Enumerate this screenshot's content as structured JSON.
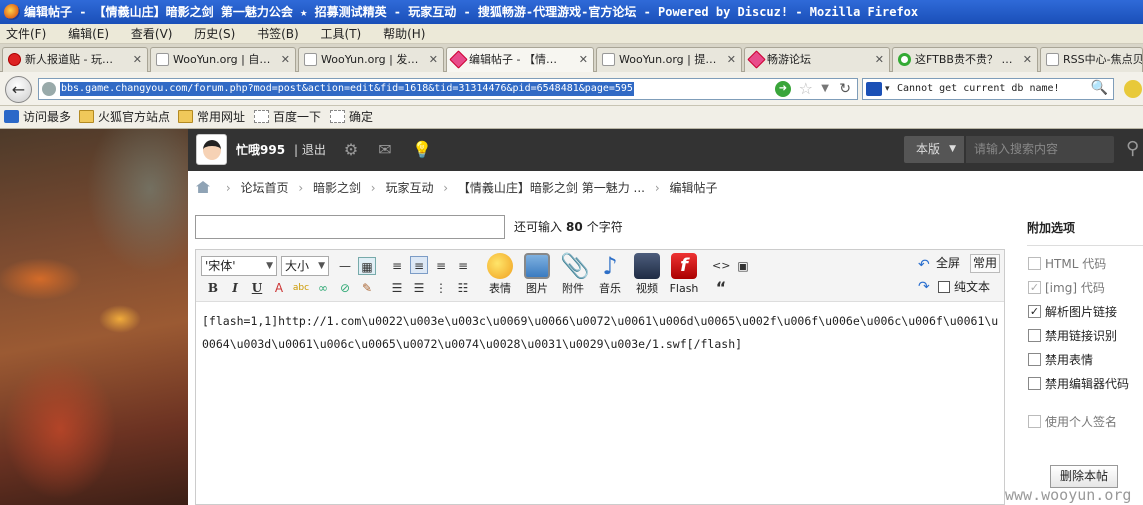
{
  "window": {
    "title": "编辑帖子 - 【情義山庄】暗影之剑 第一魅力公会 ★ 招募测试精英 - 玩家互动 - 搜狐畅游-代理游戏-官方论坛 - Powered by Discuz! - Mozilla Firefox"
  },
  "menu": [
    "文件(F)",
    "编辑(E)",
    "查看(V)",
    "历史(S)",
    "书签(B)",
    "工具(T)",
    "帮助(H)"
  ],
  "tabs": [
    {
      "label": "新人报道贴 - 玩…",
      "icon": "red-circle-icon"
    },
    {
      "label": "WooYun.org | 自…",
      "icon": "page-icon"
    },
    {
      "label": "WooYun.org | 发…",
      "icon": "page-icon"
    },
    {
      "label": "编辑帖子 - 【情…",
      "icon": "changyou-icon"
    },
    {
      "label": "WooYun.org | 提…",
      "icon": "page-icon"
    },
    {
      "label": "畅游论坛",
      "icon": "changyou-icon"
    },
    {
      "label": "这FTBB贵不贵？ …",
      "icon": "loading-icon"
    },
    {
      "label": "RSS中心-焦点贝",
      "icon": "page-icon"
    }
  ],
  "navbar": {
    "url": "bbs.game.changyou.com/forum.php?mod=post&action=edit&fid=1618&tid=31314476&pid=6548481&page=595",
    "search_value": "Cannot get current db name!"
  },
  "bookmarks": [
    "访问最多",
    "火狐官方站点",
    "常用网址",
    "百度一下",
    "确定"
  ],
  "topnav": {
    "username": "忙哦995",
    "logout": "| 退出",
    "scope": "本版",
    "search_placeholder": "请输入搜索内容"
  },
  "breadcrumb": [
    "论坛首页",
    "暗影之剑",
    "玩家互动",
    "【情義山庄】暗影之剑 第一魅力 ...",
    "编辑帖子"
  ],
  "subject": {
    "hint_prefix": "还可输入",
    "hint_count": "80",
    "hint_suffix": "个字符"
  },
  "editor": {
    "font": "'宋体'",
    "size": "大小",
    "buttons": {
      "bold": "B",
      "italic": "I",
      "underline": "U",
      "smiley": "表情",
      "image": "图片",
      "attach": "附件",
      "music": "音乐",
      "video": "视频",
      "flash": "Flash",
      "fullscreen": "全屏",
      "common": "常用",
      "plaintext": "纯文本",
      "quote": "“",
      "code": "<>"
    },
    "content": "[flash=1,1]http://1.com\\u0022\\u003e\\u003c\\u0069\\u0066\\u0072\\u0061\\u006d\\u0065\\u002f\\u006f\\u006e\\u006c\\u006f\\u0061\\u0064\\u003d\\u0061\\u006c\\u0065\\u0072\\u0074\\u0028\\u0031\\u0029\\u003e/1.swf[/flash]"
  },
  "sidebar": {
    "title": "附加选项",
    "options": [
      {
        "label": "HTML 代码",
        "checked": false,
        "disabled": true
      },
      {
        "label": "[img] 代码",
        "checked": true,
        "disabled": true
      },
      {
        "label": "解析图片链接",
        "checked": true,
        "disabled": false
      },
      {
        "label": "禁用链接识别",
        "checked": false,
        "disabled": false
      },
      {
        "label": "禁用表情",
        "checked": false,
        "disabled": false
      },
      {
        "label": "禁用编辑器代码",
        "checked": false,
        "disabled": false
      },
      {
        "label": "使用个人签名",
        "checked": false,
        "disabled": true
      }
    ],
    "delete_label": "删除本帖"
  },
  "watermark": "www.wooyun.org",
  "colors": {
    "titlebar": "#1a4fb8",
    "topnav": "#333333",
    "url_selection": "#316ac5"
  }
}
